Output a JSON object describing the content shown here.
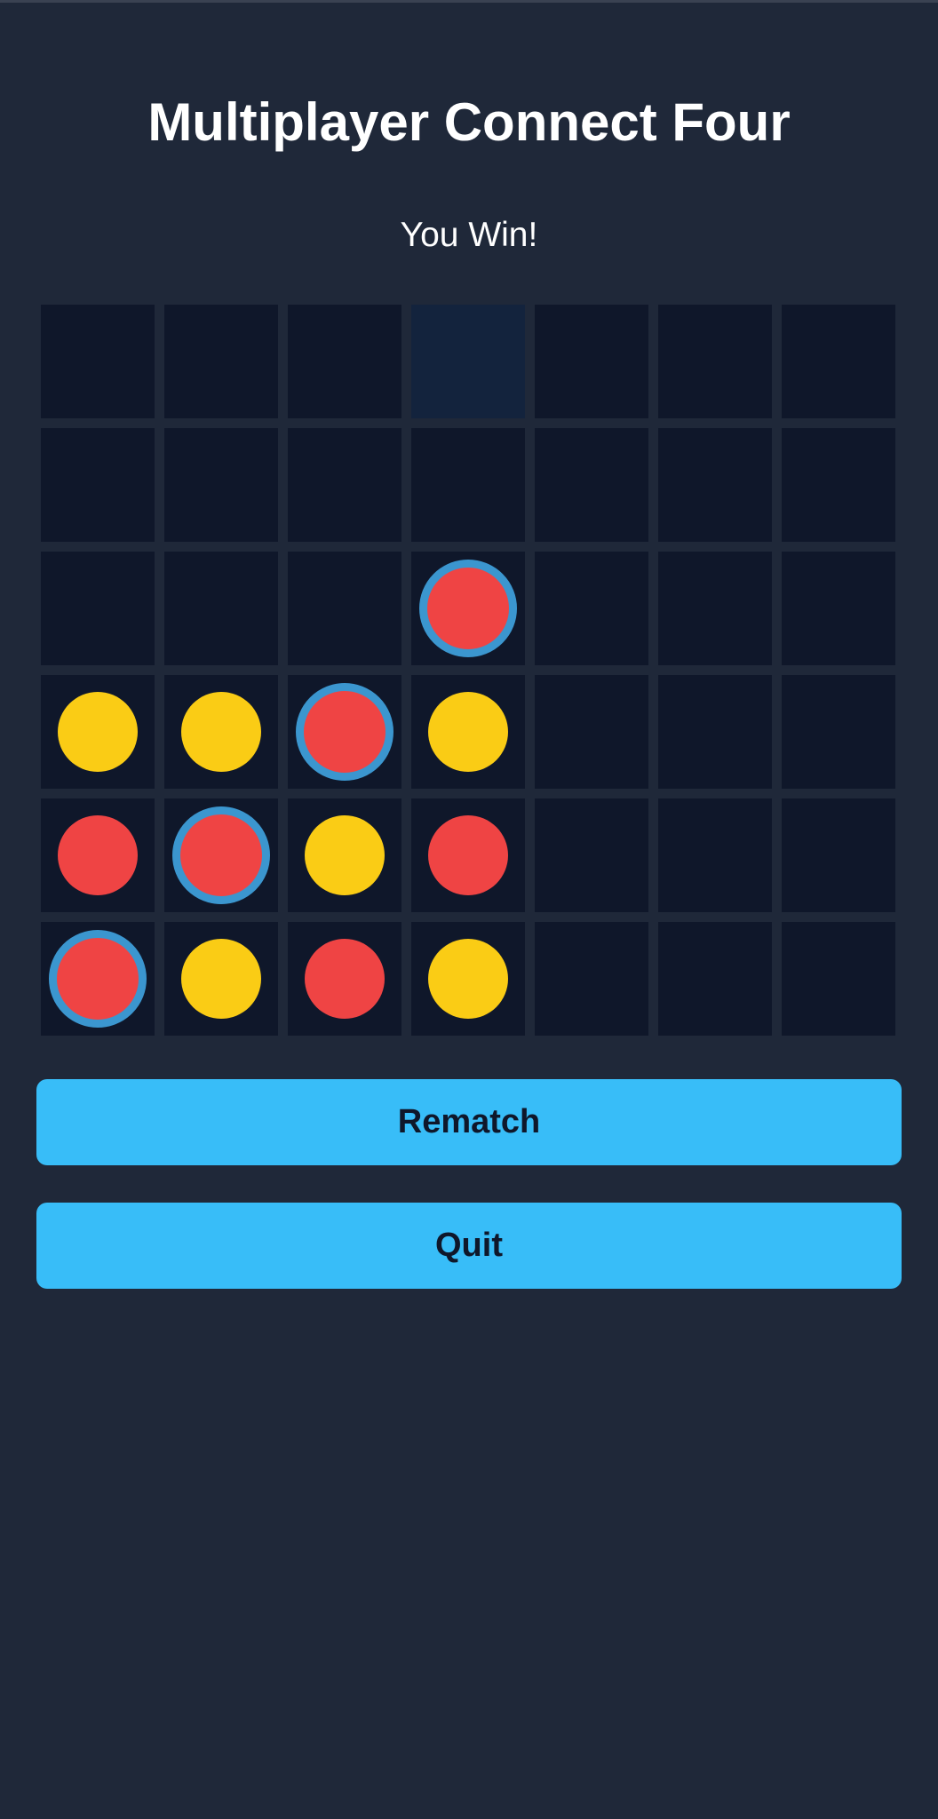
{
  "header": {
    "title": "Multiplayer Connect Four"
  },
  "status": {
    "message": "You Win!"
  },
  "board": {
    "columns": 7,
    "rows": 6,
    "hover_column": 4,
    "colors": {
      "cell": "#0f172a",
      "cell_hover": "#13233d",
      "red": "#ef4444",
      "yellow": "#facc15",
      "win_ring": "#3b96cf"
    },
    "grid": [
      [
        "",
        "",
        "",
        "",
        "",
        "",
        ""
      ],
      [
        "",
        "",
        "",
        "",
        "",
        "",
        ""
      ],
      [
        "",
        "",
        "",
        "red",
        "",
        "",
        ""
      ],
      [
        "yellow",
        "yellow",
        "red",
        "yellow",
        "",
        "",
        ""
      ],
      [
        "red",
        "red",
        "yellow",
        "red",
        "",
        "",
        ""
      ],
      [
        "red",
        "yellow",
        "red",
        "yellow",
        "",
        "",
        ""
      ]
    ],
    "winning_cells": [
      {
        "row": 6,
        "col": 1
      },
      {
        "row": 5,
        "col": 2
      },
      {
        "row": 4,
        "col": 3
      },
      {
        "row": 3,
        "col": 4
      }
    ]
  },
  "actions": {
    "rematch_label": "Rematch",
    "quit_label": "Quit",
    "button_color": "#38bdf8"
  }
}
